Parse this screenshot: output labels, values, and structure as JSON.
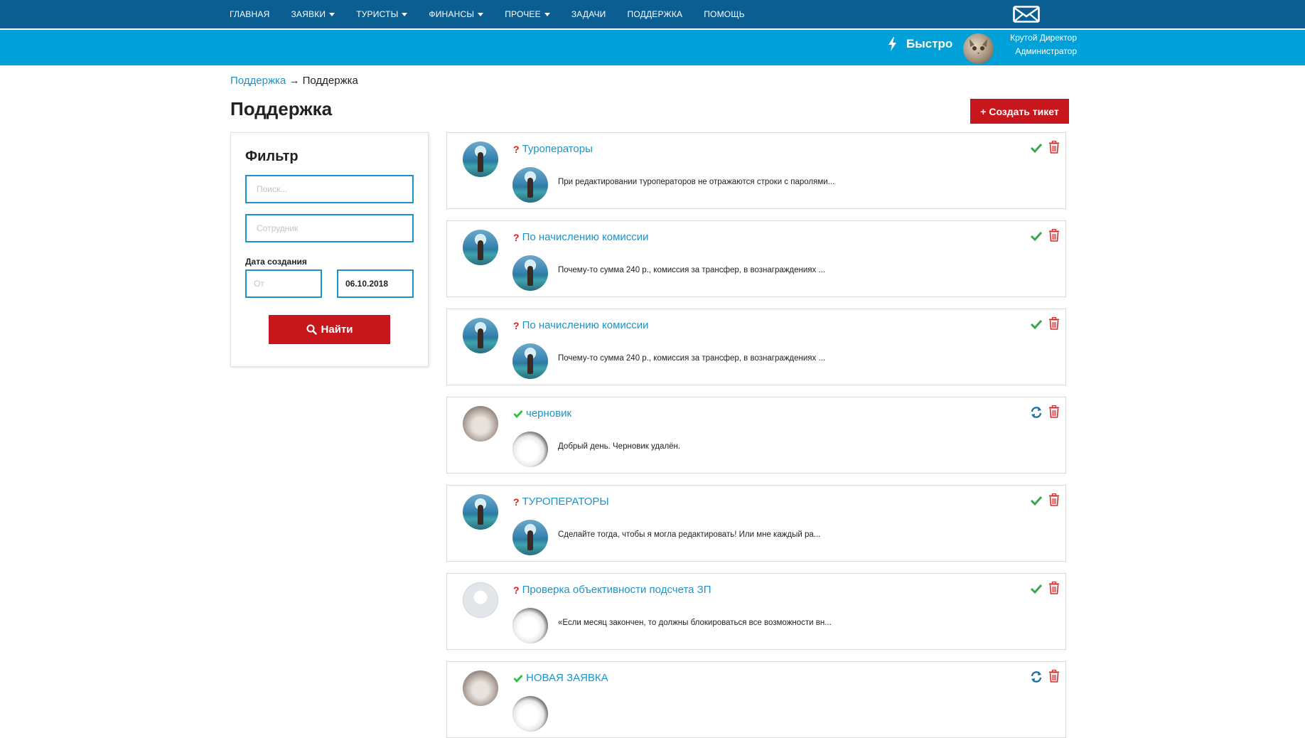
{
  "nav": {
    "items": [
      {
        "label": "ГЛАВНАЯ",
        "caret": false
      },
      {
        "label": "ЗАЯВКИ",
        "caret": true
      },
      {
        "label": "ТУРИСТЫ",
        "caret": true
      },
      {
        "label": "ФИНАНСЫ",
        "caret": true
      },
      {
        "label": "ПРОЧЕЕ",
        "caret": true
      },
      {
        "label": "ЗАДАЧИ",
        "caret": false
      },
      {
        "label": "ПОДДЕРЖКА",
        "caret": false
      },
      {
        "label": "ПОМОЩЬ",
        "caret": false
      }
    ],
    "mail_icon": "envelope-icon"
  },
  "header": {
    "quick_label": "Быстро",
    "quick_icon": "bolt-icon",
    "user_name": "Крутой Директор",
    "user_role": "Администратор"
  },
  "breadcrumb": {
    "link": "Поддержка",
    "separator": "→",
    "current": "Поддержка"
  },
  "page": {
    "title": "Поддержка",
    "create_button": "+ Создать тикет"
  },
  "filter": {
    "title": "Фильтр",
    "search_placeholder": "Поиск...",
    "employee_placeholder": "Сотрудник",
    "date_label": "Дата создания",
    "from_placeholder": "От",
    "to_value": "06.10.2018",
    "find_button": "Найти"
  },
  "tickets": [
    {
      "status": "question",
      "title": "Туроператоры",
      "message": "При редактировании туроператоров не отражаются строки с паролями...",
      "author_avatar": "sea",
      "reply_avatar": "sea",
      "action": "check"
    },
    {
      "status": "question",
      "title": "По начислению комиссии",
      "message": "Почему-то сумма 240 р., комиссия за трансфер, в вознаграждениях ...",
      "author_avatar": "sea",
      "reply_avatar": "sea",
      "action": "check"
    },
    {
      "status": "question",
      "title": "По начислению комиссии",
      "message": "Почему-то сумма 240 р., комиссия за трансфер, в вознаграждениях ...",
      "author_avatar": "sea",
      "reply_avatar": "sea",
      "action": "check"
    },
    {
      "status": "done",
      "title": "черновик",
      "message": "Добрый день. Черновик удалён.",
      "author_avatar": "cat",
      "reply_avatar": "white-cat",
      "action": "reopen"
    },
    {
      "status": "question",
      "title": "ТУРОПЕРАТОРЫ",
      "message": "Сделайте тогда, чтобы я могла редактировать! Или мне каждый ра...",
      "author_avatar": "sea",
      "reply_avatar": "sea",
      "action": "check"
    },
    {
      "status": "question",
      "title": "Проверка объективности подсчета ЗП",
      "message": "«Если месяц закончен, то должны блокироваться все возможности вн...",
      "author_avatar": "face",
      "reply_avatar": "white-cat",
      "action": "check"
    },
    {
      "status": "done",
      "title": "НОВАЯ ЗАЯВКА",
      "message": "",
      "author_avatar": "cat",
      "reply_avatar": "white-cat",
      "action": "reopen"
    }
  ],
  "colors": {
    "topbar": "#0b5e91",
    "bluebar": "#00a0d8",
    "accent_red": "#c8161d",
    "link_blue": "#1d94c9",
    "check_green": "#3aa84a"
  }
}
